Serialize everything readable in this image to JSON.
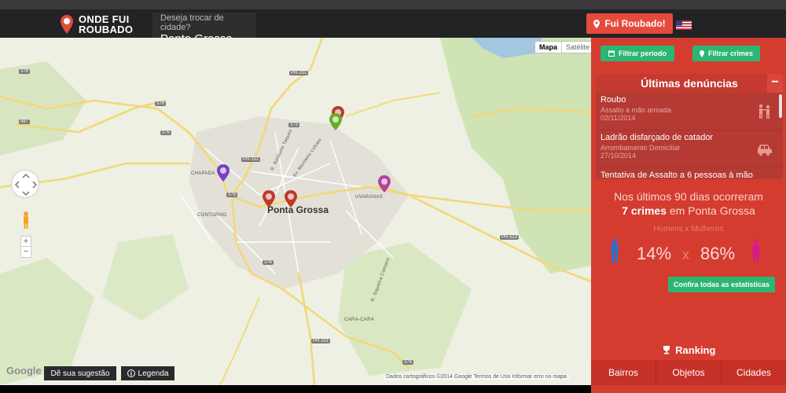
{
  "header": {
    "logo_line1": "ONDE FUI",
    "logo_line2": "ROUBADO",
    "city_prompt": "Deseja trocar de cidade?",
    "city": "Ponta Grossa",
    "robbed_button": "Fui Roubado!",
    "brand_color": "#e54b3c"
  },
  "map": {
    "type_map": "Mapa",
    "type_satellite": "Satélite",
    "city_label": "Ponta Grossa",
    "neighborhood_labels": [
      "CHAPADA",
      "CONTORNO",
      "UVARANAS",
      "CARA-CARA"
    ],
    "street_labels": [
      "R. Balduino Taques",
      "Av. Monteiro Lobato",
      "R. Siqueira Campos"
    ],
    "road_badges": [
      "376",
      "376",
      "487",
      "376",
      "PR-151",
      "373",
      "PR-151",
      "376",
      "PR-513",
      "376",
      "PR-151",
      "376"
    ],
    "zoom_in": "+",
    "zoom_out": "−",
    "google": "Google",
    "suggestion_button": "Dê sua sugestão",
    "legend_button": "Legenda",
    "attribution": "Dados cartográficos ©2014 Google    Termos de Uso    Informar erro no mapa"
  },
  "panel": {
    "filter_period": "Filtrar período",
    "filter_crimes": "Filtrar crimes",
    "recent_title": "Últimas denúncias",
    "collapse": "−",
    "crimes": [
      {
        "title": "Roubo",
        "subtitle": "Assalto à mão armada",
        "date": "02/11/2014",
        "icon": "robbery-icon"
      },
      {
        "title": "Ladrão disfarçado de catador",
        "subtitle": "Arrombamento Domiciliar",
        "date": "27/10/2014",
        "icon": "car-break-in-icon"
      },
      {
        "title": "Tentativa de Assalto a 6 pessoas à mão",
        "subtitle": "",
        "date": "",
        "icon": ""
      }
    ],
    "stats_prefix": "Nos últimos 90 dias ocorreram",
    "stats_count": "7 crimes",
    "stats_suffix": "em Ponta Grossa",
    "gender_label": "Homens x Mulheres",
    "men_pct": "14%",
    "women_pct": "86%",
    "separator": "x",
    "stats_button": "Confira todas as estatísticas",
    "ranking_title": "Ranking",
    "ranking_tabs": [
      "Bairros",
      "Objetos",
      "Cidades"
    ],
    "accent_green": "#2bb673",
    "panel_red": "#d43c30"
  }
}
